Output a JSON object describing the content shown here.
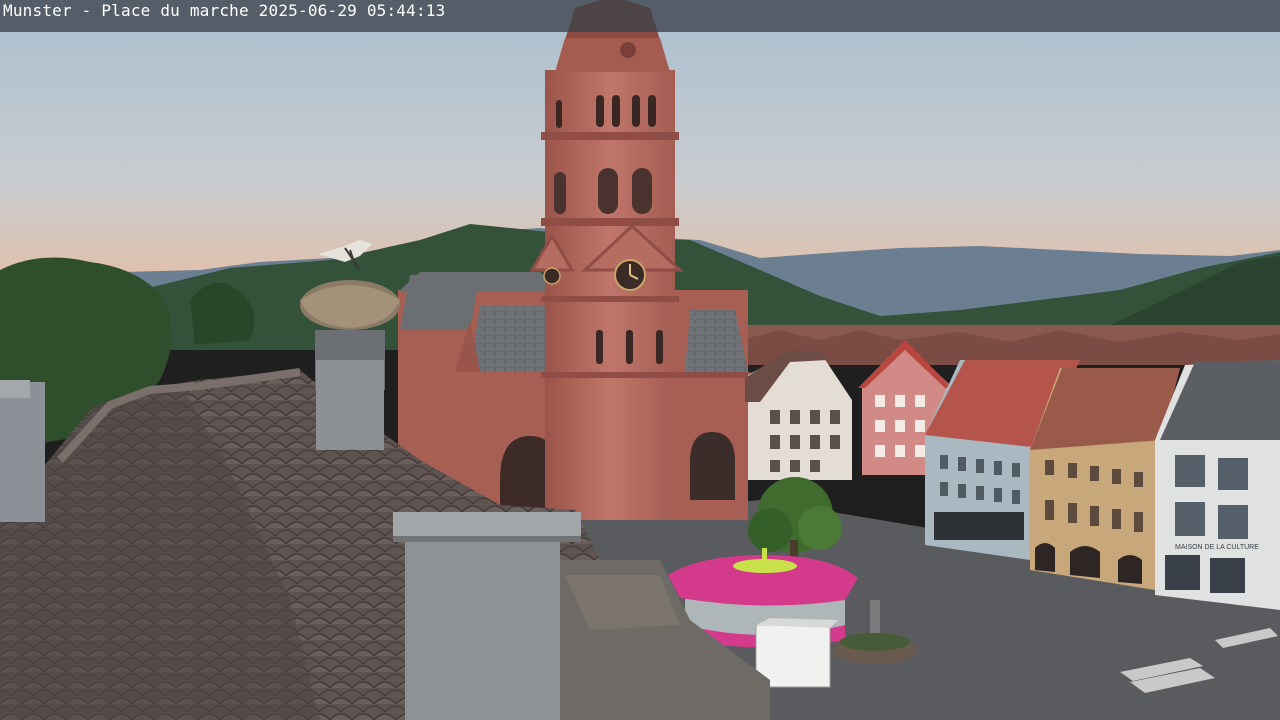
{
  "overlay": {
    "caption": "Munster - Place du marche 2025-06-29 05:44:13"
  },
  "scene": {
    "subject": "webcam view of market square with red sandstone church tower",
    "colors": {
      "sky_top": "#b3c5d3",
      "sky_bottom": "#e9bf9f",
      "far_hills": "#6f8296",
      "mid_hills": "#3c5a44",
      "forest": "#2e4a31",
      "sandstone": "#b86a5e",
      "sandstone_dark": "#8f4d45",
      "slate_roof": "#6b6e72",
      "tile_roof": "#5a4f4c",
      "red_roof": "#a9544a",
      "pavement": "#57585b",
      "carousel": "#d43a8c",
      "tree": "#3f6b2f"
    },
    "storefront_sign": "MAISON DE LA CULTURE",
    "clock": "church-clock"
  }
}
